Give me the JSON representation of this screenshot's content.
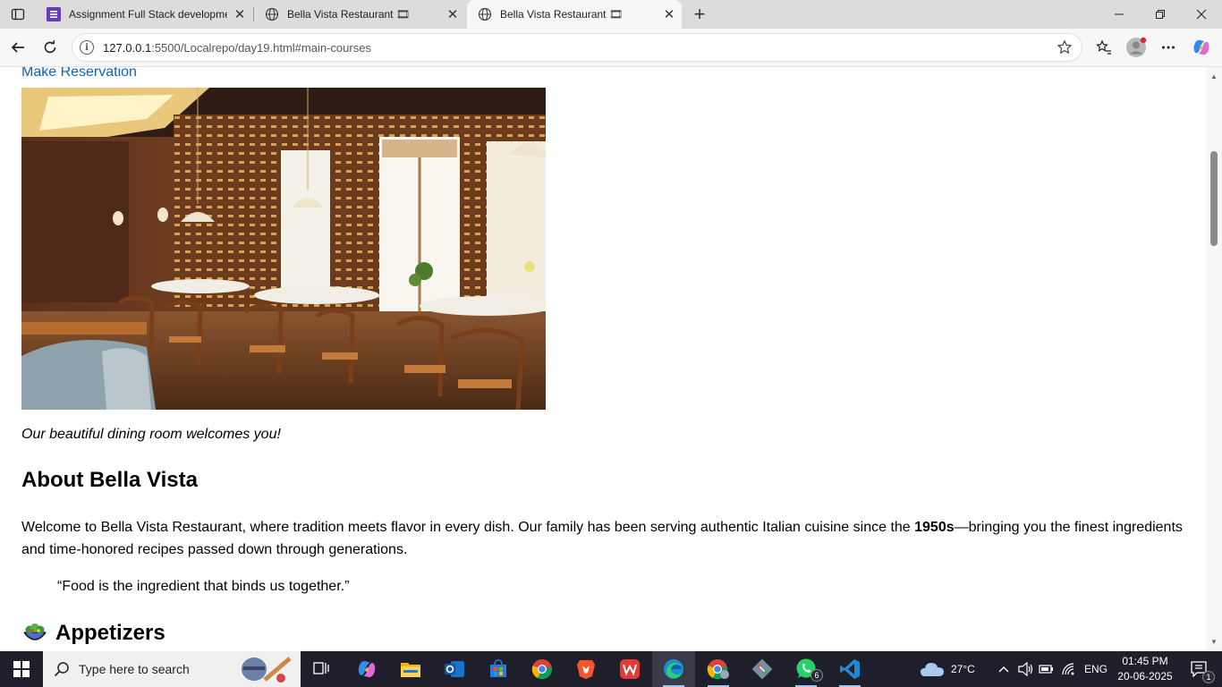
{
  "browser": {
    "tabs": [
      {
        "title": "Assignment Full Stack developme",
        "active": false
      },
      {
        "title": "Bella Vista Restaurant 🎞",
        "active": false
      },
      {
        "title": "Bella Vista Restaurant 🎞",
        "active": true
      }
    ],
    "url_host": "127.0.0.1",
    "url_rest": ":5500/Localrepo/day19.html#main-courses"
  },
  "page": {
    "reservation_link": "Make Reservation",
    "image_caption": "Our beautiful dining room welcomes you!",
    "about_heading": "About Bella Vista",
    "about_text_before": "Welcome to Bella Vista Restaurant, where tradition meets flavor in every dish. Our family has been serving authentic Italian cuisine since the ",
    "about_text_bold": "1950s",
    "about_text_after": "—bringing you the finest ingredients and time-honored recipes passed down through generations.",
    "quote": "“Food is the ingredient that binds us together.”",
    "appetizers_heading": "Appetizers"
  },
  "taskbar": {
    "search_placeholder": "Type here to search",
    "weather": "27°C",
    "language": "ENG",
    "time": "01:45 PM",
    "date": "20-06-2025",
    "whatsapp_badge": "6",
    "notification_count": "1"
  },
  "colors": {
    "link": "#0b64c0",
    "tabstrip": "#dcdcdc",
    "taskbar": "#1f1f2b"
  }
}
